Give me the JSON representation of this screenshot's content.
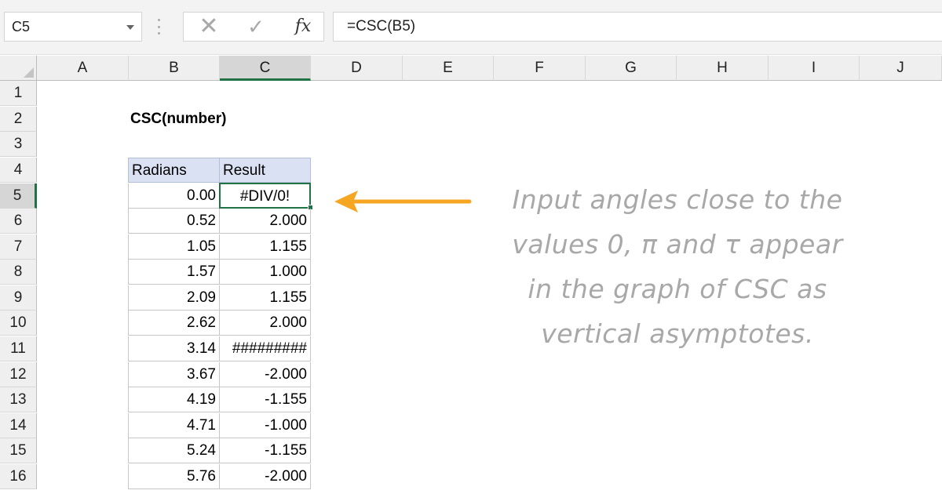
{
  "formula_bar": {
    "name_box": "C5",
    "cancel_symbol": "✕",
    "enter_symbol": "✓",
    "fx_label": "fx",
    "formula": "=CSC(B5)"
  },
  "columns": [
    "A",
    "B",
    "C",
    "D",
    "E",
    "F",
    "G",
    "H",
    "I",
    "J"
  ],
  "rows": [
    "1",
    "2",
    "3",
    "4",
    "5",
    "6",
    "7",
    "8",
    "9",
    "10",
    "11",
    "12",
    "13",
    "14",
    "15",
    "16"
  ],
  "sheet": {
    "title": "CSC(number)",
    "header_radians": "Radians",
    "header_result": "Result",
    "data": [
      {
        "radians": "0.00",
        "result": "#DIV/0!"
      },
      {
        "radians": "0.52",
        "result": "2.000"
      },
      {
        "radians": "1.05",
        "result": "1.155"
      },
      {
        "radians": "1.57",
        "result": "1.000"
      },
      {
        "radians": "2.09",
        "result": "1.155"
      },
      {
        "radians": "2.62",
        "result": "2.000"
      },
      {
        "radians": "3.14",
        "result": "#########"
      },
      {
        "radians": "3.67",
        "result": "-2.000"
      },
      {
        "radians": "4.19",
        "result": "-1.155"
      },
      {
        "radians": "4.71",
        "result": "-1.000"
      },
      {
        "radians": "5.24",
        "result": "-1.155"
      },
      {
        "radians": "5.76",
        "result": "-2.000"
      }
    ]
  },
  "annotation": {
    "line1": "Input angles close to the",
    "line2": "values 0, π and τ appear",
    "line3": "in the graph of CSC as",
    "line4": "vertical asymptotes."
  },
  "colors": {
    "accent_green": "#217346",
    "arrow_orange": "#f5a623",
    "table_header_fill": "#d9e1f2"
  }
}
